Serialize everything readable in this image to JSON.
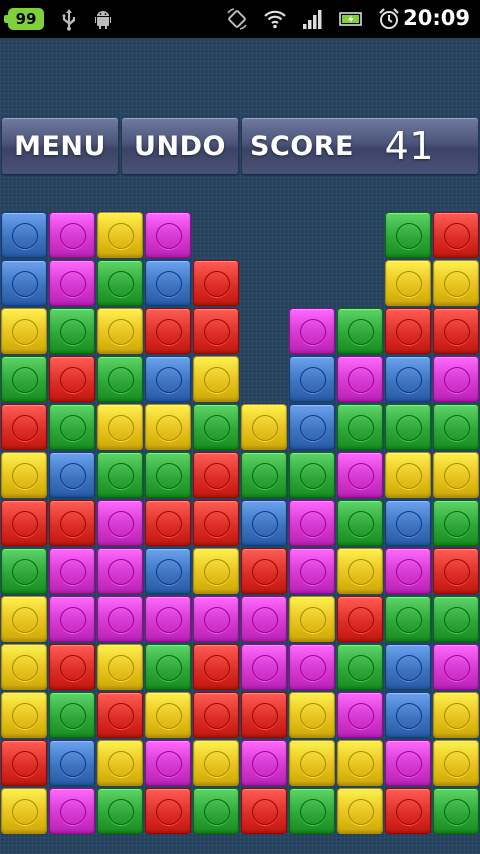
{
  "status_bar": {
    "battery": "99",
    "time": "20:09",
    "icons": [
      "usb-icon",
      "android-debug-icon",
      "screen-rotation-icon",
      "wifi-icon",
      "signal-icon",
      "battery-charging-icon",
      "alarm-clock-icon"
    ]
  },
  "header": {
    "menu_label": "MENU",
    "undo_label": "UNDO",
    "score_label": "SCORE",
    "score_value": "41"
  },
  "colors": {
    "B": "#3f74c0",
    "M": "#d63ad0",
    "Y": "#e6c31f",
    "G": "#2fa73a",
    "R": "#dc3027"
  },
  "board": {
    "columns": 10,
    "rows": 13,
    "legend": {
      "B": "blue",
      "M": "magenta",
      "Y": "yellow",
      "G": "green",
      "R": "red",
      ".": "empty"
    },
    "grid": [
      "BMYM....GR",
      "BMGBR...YY",
      "YGYRR.MGRR",
      "GRGBY.BMBM",
      "RGYYGYBGGG",
      "YBGGRGGMYY",
      "RRMRRBMGBG",
      "GMMBYRMYMR",
      "YMMMMMYRGG",
      "YRYGRMMGBM",
      "YGRYRRYMBY",
      "RBYMYMYYMY",
      "YMGRGRGYRG"
    ]
  }
}
